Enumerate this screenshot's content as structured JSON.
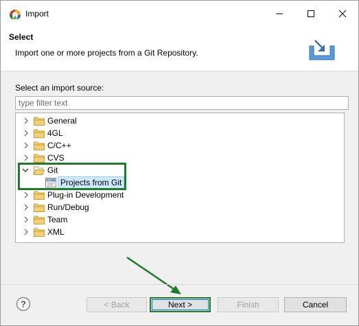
{
  "window": {
    "title": "Import"
  },
  "header": {
    "title": "Select",
    "description": "Import one or more projects from a Git Repository."
  },
  "source_label": "Select an import source:",
  "filter": {
    "placeholder": "type filter text",
    "value": ""
  },
  "tree": {
    "items": [
      {
        "label": "General",
        "expanded": false
      },
      {
        "label": "4GL",
        "expanded": false
      },
      {
        "label": "C/C++",
        "expanded": false
      },
      {
        "label": "CVS",
        "expanded": false
      },
      {
        "label": "Git",
        "expanded": true
      },
      {
        "label": "Projects from Git",
        "child": true,
        "selected": true
      },
      {
        "label": "Plug-in Development",
        "expanded": false
      },
      {
        "label": "Run/Debug",
        "expanded": false
      },
      {
        "label": "Team",
        "expanded": false
      },
      {
        "label": "XML",
        "expanded": false
      }
    ]
  },
  "buttons": {
    "back": "< Back",
    "next": "Next >",
    "finish": "Finish",
    "cancel": "Cancel",
    "help": "?"
  },
  "colors": {
    "highlight": "#1f7a2a",
    "selection": "#cce8ff",
    "folder": "#e8b44c"
  }
}
